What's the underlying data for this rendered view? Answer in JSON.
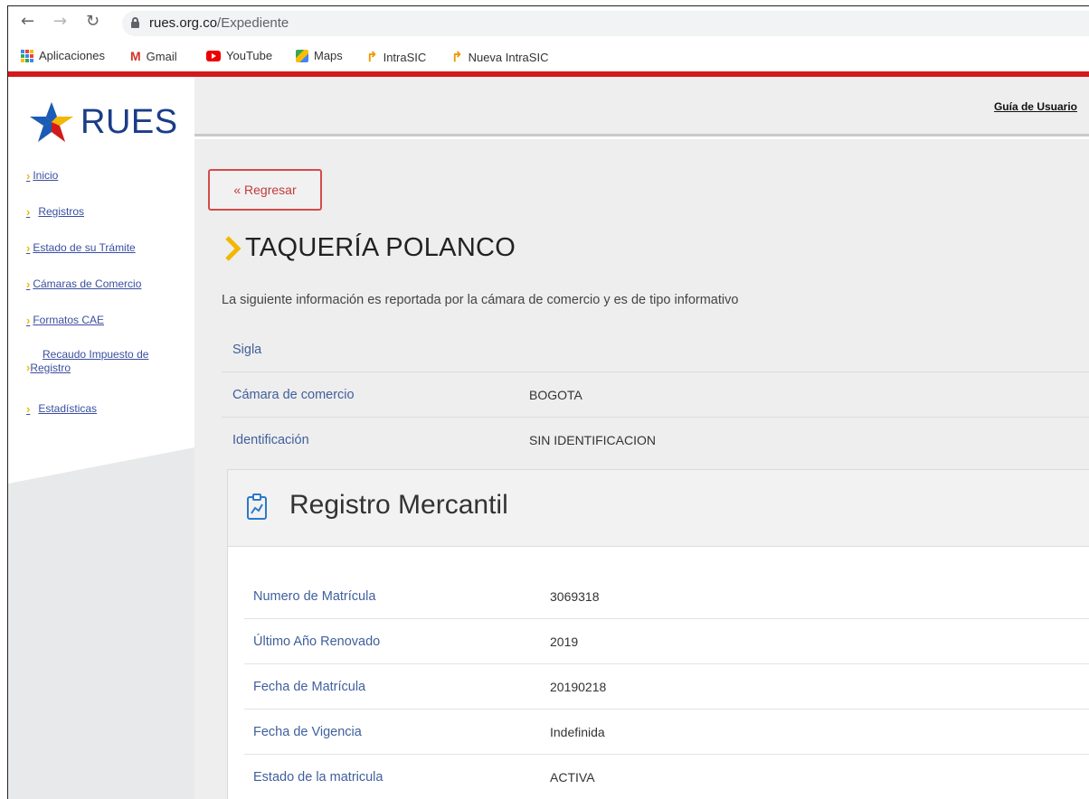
{
  "browser": {
    "url_domain": "rues.org.co",
    "url_path": "/Expediente",
    "bookmarks": [
      {
        "label": "Aplicaciones",
        "icon": "apps-grid-icon"
      },
      {
        "label": "Gmail",
        "icon": "gmail-icon"
      },
      {
        "label": "YouTube",
        "icon": "youtube-icon"
      },
      {
        "label": "Maps",
        "icon": "maps-icon"
      },
      {
        "label": "IntraSIC",
        "icon": "intrasic-icon"
      },
      {
        "label": "Nueva IntraSIC",
        "icon": "intrasic-icon"
      }
    ]
  },
  "site": {
    "logo_text": "RUES",
    "guide_link": "Guía de Usuario",
    "accent_red": "#d3191c",
    "accent_yellow": "#f2b705"
  },
  "sidebar": {
    "items": [
      {
        "label": "Inicio"
      },
      {
        "label": "Registros"
      },
      {
        "label": "Estado de su Trámite"
      },
      {
        "label": "Cámaras de Comercio"
      },
      {
        "label": "Formatos CAE"
      },
      {
        "label_line1": "Recaudo Impuesto de",
        "label_line2": "Registro"
      },
      {
        "label": "Estadísticas"
      }
    ]
  },
  "main": {
    "back_button": "« Regresar",
    "title": "TAQUERÍA POLANCO",
    "lead": "La siguiente información es reportada por la cámara de comercio y es de tipo informativo",
    "info": [
      {
        "label": "Sigla",
        "value": ""
      },
      {
        "label": "Cámara de comercio",
        "value": "BOGOTA"
      },
      {
        "label": "Identificación",
        "value": "SIN IDENTIFICACION"
      }
    ],
    "card": {
      "title": "Registro Mercantil",
      "rows": [
        {
          "label": "Numero de Matrícula",
          "value": "3069318"
        },
        {
          "label": "Último Año Renovado",
          "value": "2019"
        },
        {
          "label": "Fecha de Matrícula",
          "value": "20190218"
        },
        {
          "label": "Fecha de Vigencia",
          "value": "Indefinida"
        },
        {
          "label": "Estado de la matricula",
          "value": "ACTIVA"
        }
      ]
    }
  }
}
